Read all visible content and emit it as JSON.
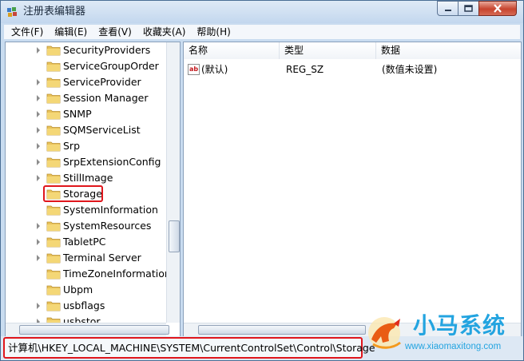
{
  "window": {
    "title": "注册表编辑器",
    "controls": {
      "minimize": "minimize-icon",
      "maximize": "maximize-icon",
      "close": "close-icon"
    }
  },
  "menu": [
    "文件(F)",
    "编辑(E)",
    "查看(V)",
    "收藏夹(A)",
    "帮助(H)"
  ],
  "tree": {
    "items": [
      {
        "label": "SecurityProviders",
        "expandable": true
      },
      {
        "label": "ServiceGroupOrder",
        "expandable": false
      },
      {
        "label": "ServiceProvider",
        "expandable": true
      },
      {
        "label": "Session Manager",
        "expandable": true
      },
      {
        "label": "SNMP",
        "expandable": true
      },
      {
        "label": "SQMServiceList",
        "expandable": true
      },
      {
        "label": "Srp",
        "expandable": true
      },
      {
        "label": "SrpExtensionConfig",
        "expandable": true
      },
      {
        "label": "StillImage",
        "expandable": true
      },
      {
        "label": "Storage",
        "expandable": false,
        "selected": true
      },
      {
        "label": "SystemInformation",
        "expandable": false
      },
      {
        "label": "SystemResources",
        "expandable": true
      },
      {
        "label": "TabletPC",
        "expandable": true
      },
      {
        "label": "Terminal Server",
        "expandable": true
      },
      {
        "label": "TimeZoneInformation",
        "expandable": false
      },
      {
        "label": "Ubpm",
        "expandable": false
      },
      {
        "label": "usbflags",
        "expandable": true
      },
      {
        "label": "usbstor",
        "expandable": true
      }
    ]
  },
  "values_list": {
    "columns": [
      "名称",
      "类型",
      "数据"
    ],
    "rows": [
      {
        "icon": "ab",
        "name": "(默认)",
        "type": "REG_SZ",
        "data": "(数值未设置)"
      }
    ]
  },
  "statusbar": {
    "path": "计算机\\HKEY_LOCAL_MACHINE\\SYSTEM\\CurrentControlSet\\Control\\Storage"
  },
  "watermark": {
    "title": "小马系统",
    "url": "www.xiaomaxitong.com"
  },
  "colors": {
    "highlight_box": "#e0161c",
    "folder": "#e8c25a",
    "watermark": "#23a4e0"
  }
}
